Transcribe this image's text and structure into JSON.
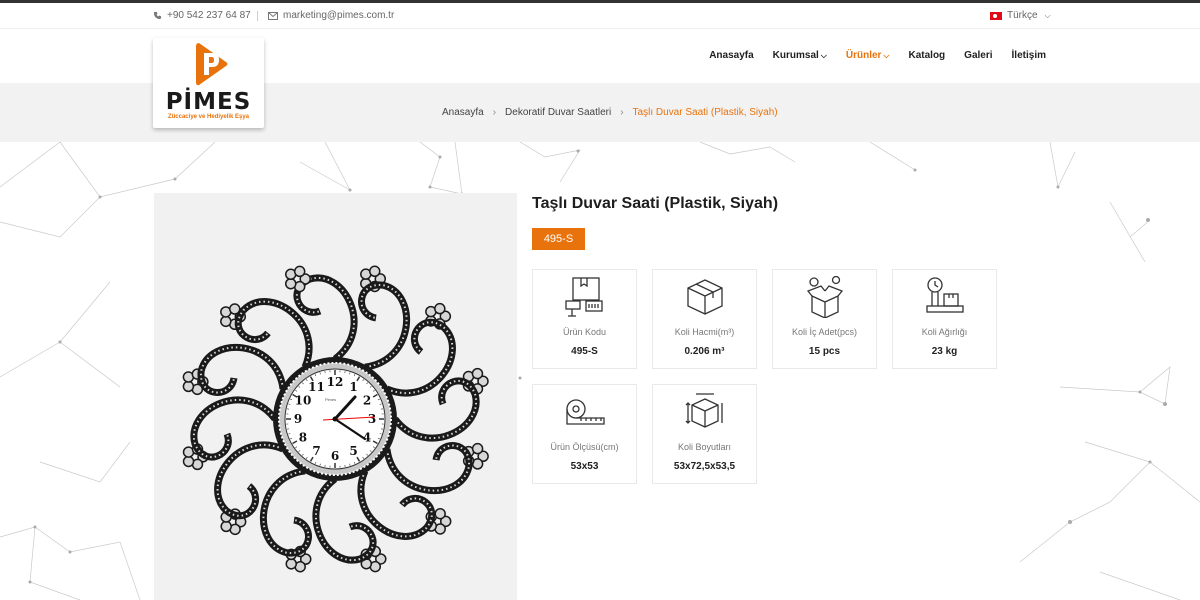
{
  "topbar": {
    "phone": "+90 542 237 64 87",
    "email": "marketing@pimes.com.tr",
    "language": "Türkçe"
  },
  "logo": {
    "word": "PİMES",
    "tagline": "Züccaciye ve Hediyelik Eşya"
  },
  "nav": [
    {
      "label": "Anasayfa",
      "dropdown": false,
      "active": false
    },
    {
      "label": "Kurumsal",
      "dropdown": true,
      "active": false
    },
    {
      "label": "Ürünler",
      "dropdown": true,
      "active": true
    },
    {
      "label": "Katalog",
      "dropdown": false,
      "active": false
    },
    {
      "label": "Galeri",
      "dropdown": false,
      "active": false
    },
    {
      "label": "İletişim",
      "dropdown": false,
      "active": false
    }
  ],
  "breadcrumb": [
    "Anasayfa",
    "Dekoratif Duvar Saatleri",
    "Taşlı Duvar Saati (Plastik, Siyah)"
  ],
  "product": {
    "title": "Taşlı Duvar Saati (Plastik, Siyah)",
    "code": "495-S",
    "clock_brand": "Pimes",
    "clock_numbers": [
      "12",
      "1",
      "2",
      "3",
      "4",
      "5",
      "6",
      "7",
      "8",
      "9",
      "10",
      "11"
    ]
  },
  "specs": [
    {
      "icon": "product-code-icon",
      "label": "Ürün Kodu",
      "value": "495-S"
    },
    {
      "icon": "box-volume-icon",
      "label": "Koli Hacmi(m³)",
      "value": "0.206 m³"
    },
    {
      "icon": "box-quantity-icon",
      "label": "Koli İç Adet(pcs)",
      "value": "15 pcs"
    },
    {
      "icon": "scale-weight-icon",
      "label": "Koli Ağırlığı",
      "value": "23 kg"
    },
    {
      "icon": "measuring-tape-icon",
      "label": "Ürün Ölçüsü(cm)",
      "value": "53x53"
    },
    {
      "icon": "box-dimensions-icon",
      "label": "Koli Boyutları",
      "value": "53x72,5x53,5"
    }
  ],
  "colors": {
    "accent": "#e8730c",
    "text": "#222222",
    "crumb_bg": "#f2f2f2"
  }
}
